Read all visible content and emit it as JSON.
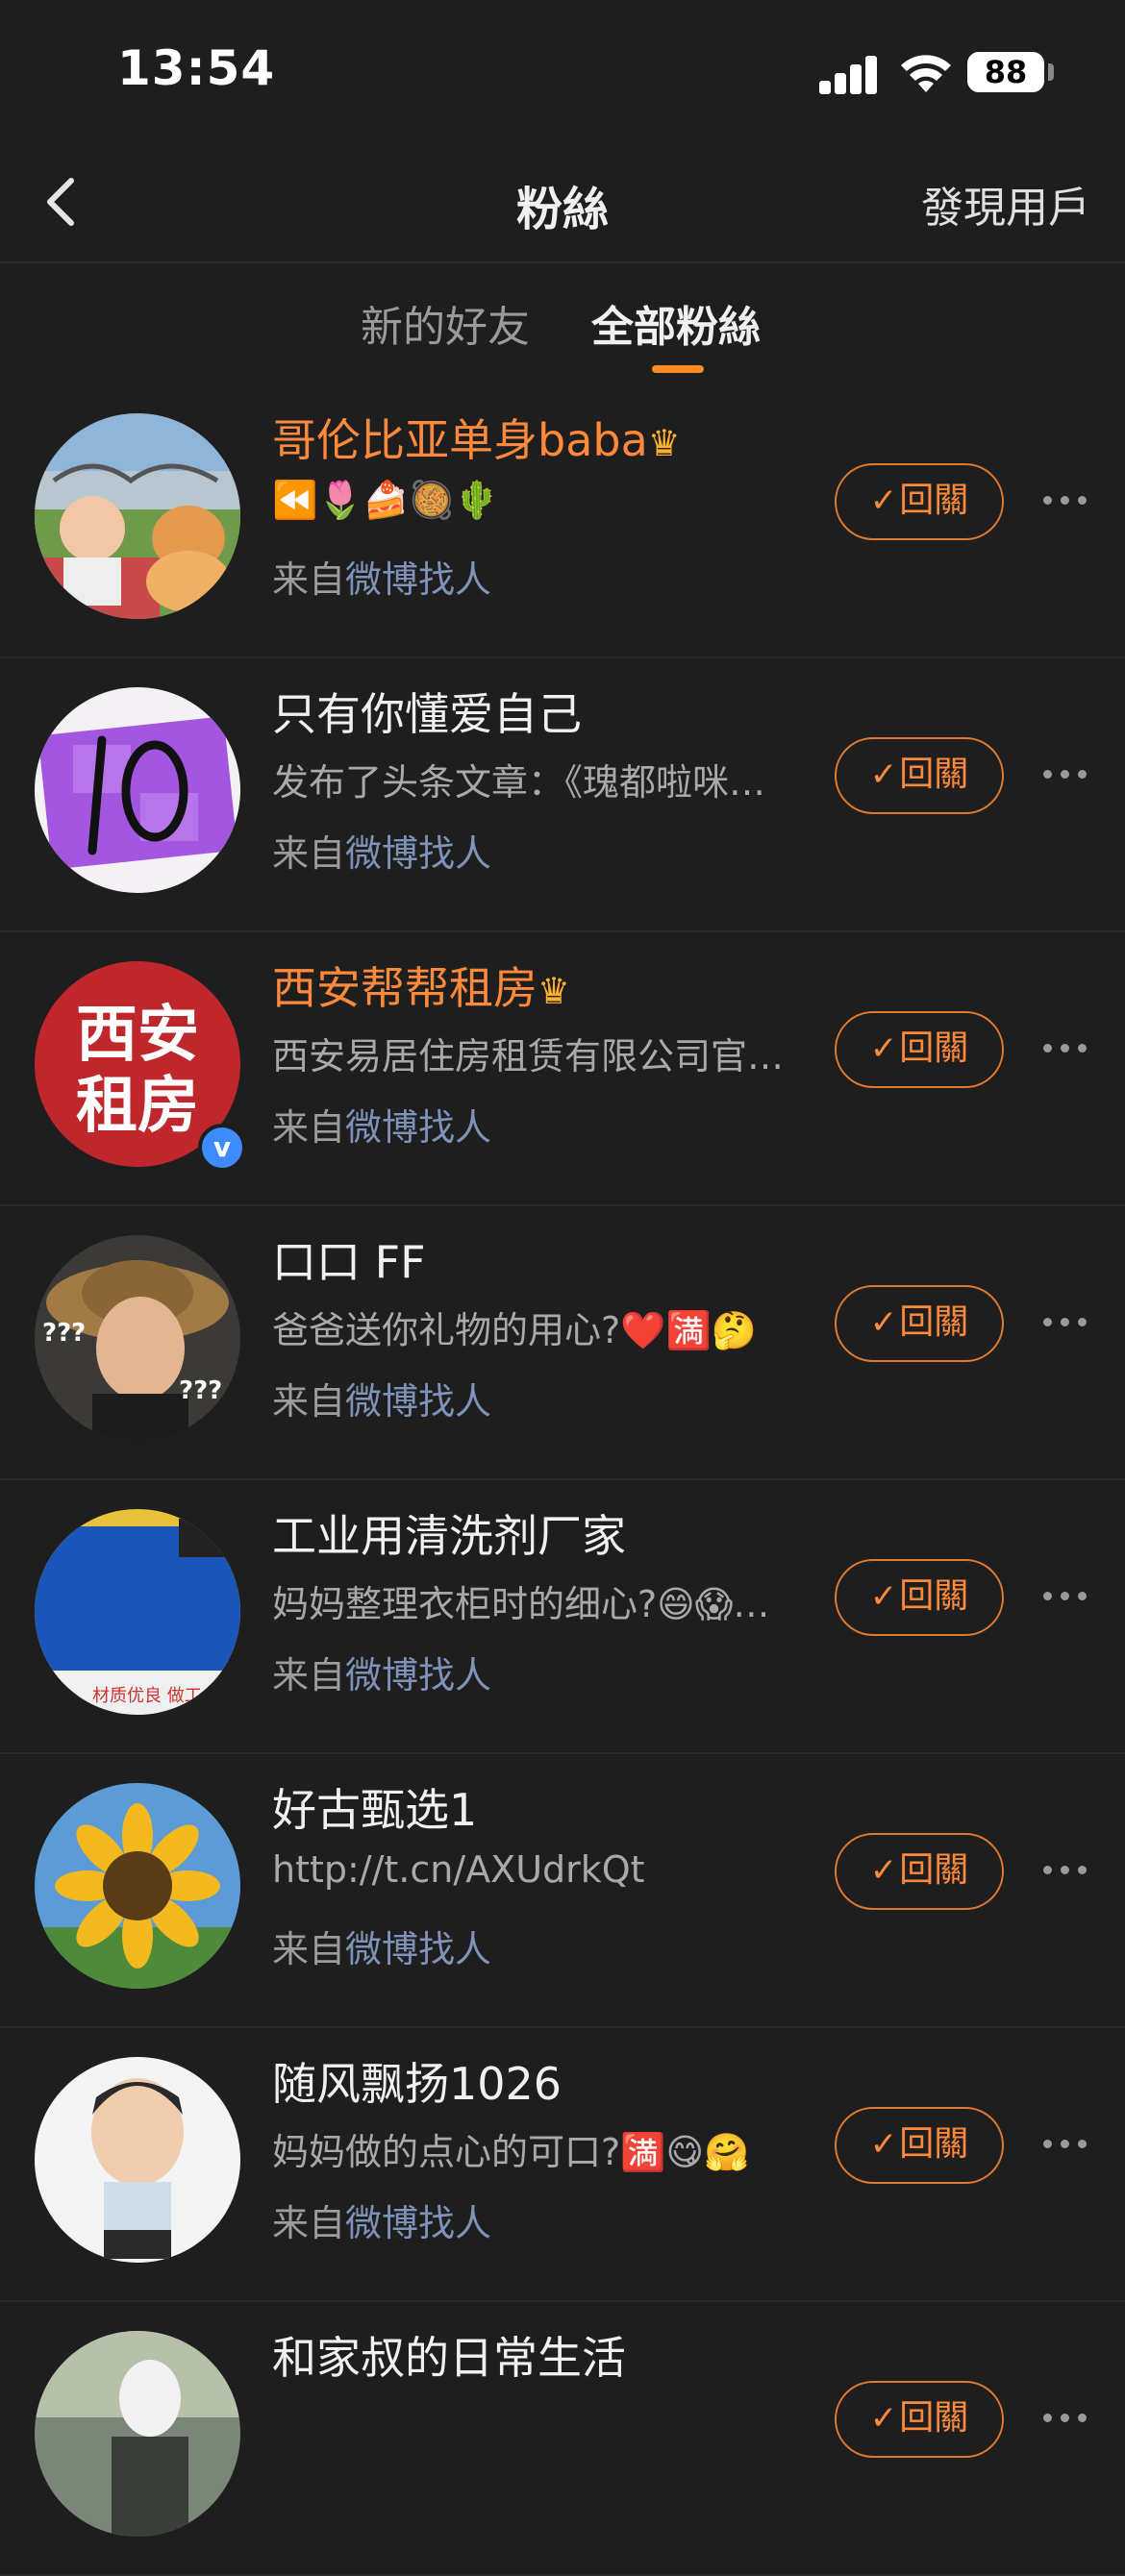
{
  "status": {
    "time": "13:54",
    "battery": "88"
  },
  "nav": {
    "title": "粉絲",
    "right": "發現用戶"
  },
  "tabs": [
    {
      "label": "新的好友"
    },
    {
      "label": "全部粉絲"
    }
  ],
  "follow_label": "回關",
  "source_prefix": "来自",
  "source_via": "微博找人",
  "users": [
    {
      "name": "哥伦比亚单身baba",
      "vip": true,
      "desc": "⏪🌷🍰🥘🌵"
    },
    {
      "name": "只有你懂爱自己",
      "vip": false,
      "desc": "发布了头条文章：《瑰都啦咪…"
    },
    {
      "name": "西安帮帮租房",
      "vip": true,
      "verified": true,
      "desc": "西安易居住房租赁有限公司官…",
      "avatar_text": "西安租房"
    },
    {
      "name": "口口 FF",
      "vip": false,
      "desc": "爸爸送你礼物的用心?❤️🈵🤔"
    },
    {
      "name": "工业用清洗剂厂家",
      "vip": false,
      "desc": "妈妈整理衣柜时的细心?😄😱…"
    },
    {
      "name": "好古甄选1",
      "vip": false,
      "desc": "http://t.cn/AXUdrkQt"
    },
    {
      "name": "随风飘扬1026",
      "vip": false,
      "desc": "妈妈做的点心的可口?🈵😋🤗"
    },
    {
      "name": "和家叔的日常生活",
      "vip": false,
      "desc": ""
    }
  ]
}
